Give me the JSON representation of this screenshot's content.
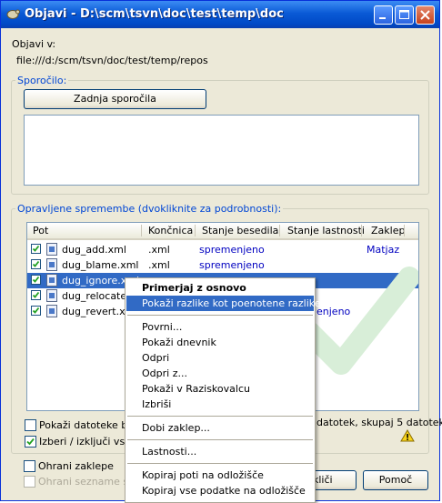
{
  "window": {
    "title": "Objavi - D:\\scm\\tsvn\\doc\\test\\temp\\doc"
  },
  "commit_to": {
    "label": "Objavi v:",
    "url": "file:///d:/scm/tsvn/doc/test/temp/repos"
  },
  "message": {
    "legend": "Sporočilo:",
    "recent_button": "Zadnja sporočila"
  },
  "changes": {
    "legend": "Opravljene spremembe (dvokliknite za podrobnosti):",
    "columns": [
      "Pot",
      "Končnica",
      "Stanje besedila",
      "Stanje lastnosti",
      "Zaklep"
    ],
    "rows": [
      {
        "path": "dug_add.xml",
        "ext": ".xml",
        "text_status": "spremenjeno",
        "prop_status": "",
        "lock": "Matjaz",
        "checked": true,
        "selected": false
      },
      {
        "path": "dug_blame.xml",
        "ext": ".xml",
        "text_status": "spremenjeno",
        "prop_status": "",
        "lock": "",
        "checked": true,
        "selected": false
      },
      {
        "path": "dug_ignore.xml",
        "ext": "",
        "text_status": "",
        "prop_status": "",
        "lock": "",
        "checked": true,
        "selected": true
      },
      {
        "path": "dug_relocate.x",
        "ext": "",
        "text_status": "",
        "prop_status": "",
        "lock": "",
        "checked": true,
        "selected": false
      },
      {
        "path": "dug_revert.xml",
        "ext": "",
        "text_status": "",
        "prop_status": "enjeno",
        "lock": "",
        "checked": true,
        "selected": false
      }
    ],
    "show_unversioned": "Pokaži datoteke bre",
    "select_all": "Izberi / izključi vse",
    "summary": "datotek, skupaj 5 datotek"
  },
  "options": {
    "keep_locks": "Ohrani zaklepe",
    "keep_changelists": "Ohrani sezname spr"
  },
  "buttons": {
    "ok": "kliči",
    "help": "Pomoč"
  },
  "context_menu": {
    "items": [
      {
        "label": "Primerjaj z osnovo",
        "bold": true
      },
      {
        "label": "Pokaži razlike kot poenotene razlike",
        "highlighted": true
      },
      {
        "separator": true
      },
      {
        "label": "Povrni..."
      },
      {
        "label": "Pokaži dnevnik"
      },
      {
        "label": "Odpri"
      },
      {
        "label": "Odpri z..."
      },
      {
        "label": "Pokaži v Raziskovalcu"
      },
      {
        "label": "Izbriši"
      },
      {
        "separator": true
      },
      {
        "label": "Dobi zaklep..."
      },
      {
        "separator": true
      },
      {
        "label": "Lastnosti..."
      },
      {
        "separator": true
      },
      {
        "label": "Kopiraj poti na odložišče"
      },
      {
        "label": "Kopiraj vse podatke na odložišče"
      }
    ]
  },
  "colors": {
    "accent": "#316ac5",
    "status_text": "#0000c0",
    "legend": "#0046d5"
  }
}
